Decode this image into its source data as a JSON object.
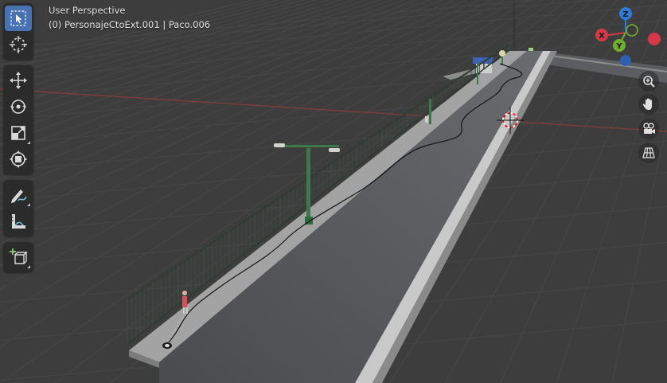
{
  "viewport": {
    "view_name": "User Perspective",
    "object_info": "(0) PersonajeCtoExt.001 | Paco.006"
  },
  "toolbar": {
    "tools": [
      {
        "name": "select-box-tool",
        "icon": "select-box-icon",
        "active": true
      },
      {
        "name": "cursor-tool",
        "icon": "cursor-icon",
        "active": false
      },
      {
        "name": "move-tool",
        "icon": "move-icon",
        "active": false
      },
      {
        "name": "rotate-tool",
        "icon": "rotate-icon",
        "active": false
      },
      {
        "name": "scale-tool",
        "icon": "scale-icon",
        "active": false
      },
      {
        "name": "transform-tool",
        "icon": "transform-icon",
        "active": false
      },
      {
        "name": "annotate-tool",
        "icon": "annotate-icon",
        "active": false
      },
      {
        "name": "measure-tool",
        "icon": "measure-icon",
        "active": false
      },
      {
        "name": "add-cube-tool",
        "icon": "add-cube-icon",
        "active": false
      }
    ]
  },
  "gizmo": {
    "axes": [
      {
        "label": "Z",
        "color": "#2f7bd8"
      },
      {
        "label": "X",
        "color": "#d63a48"
      },
      {
        "label": "Y",
        "color": "#6fb02a"
      }
    ]
  },
  "nav": {
    "buttons": [
      {
        "name": "zoom-button",
        "icon": "zoom-icon"
      },
      {
        "name": "pan-button",
        "icon": "hand-icon"
      },
      {
        "name": "camera-view-button",
        "icon": "camera-icon"
      },
      {
        "name": "perspective-toggle-button",
        "icon": "grid-icon"
      }
    ]
  },
  "colors": {
    "background": "#3d3d3d",
    "grid": "#474747",
    "x_axis_line": "#8a3b3b",
    "active_tool": "#4772b3",
    "toolbar_bg": "#2b2b2b"
  }
}
